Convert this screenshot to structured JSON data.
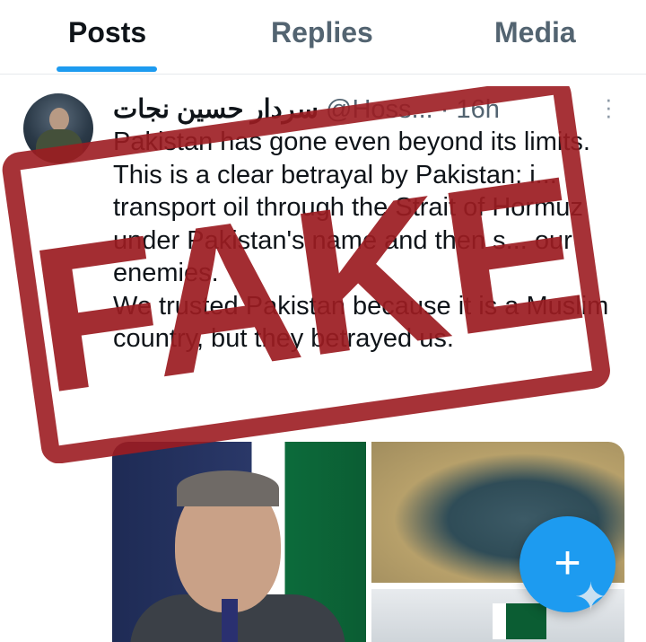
{
  "tabs": [
    {
      "label": "Posts"
    },
    {
      "label": "Replies"
    },
    {
      "label": "Media"
    }
  ],
  "post": {
    "display_name": "سردار حسين نجات",
    "handle": "@Hoss... · 16h",
    "text_lines": [
      "Pakistan has gone even beyond its limits.",
      "This is a clear betrayal by Pakistan: i... transport oil through the Strait of Hormuz under Pakistan's name and then s... our enemies.",
      "We trusted Pakistan because it is a Muslim country, but they betrayed us."
    ]
  },
  "stamp": {
    "text": "FAKE",
    "color": "#9c1c21"
  },
  "fab": {
    "icon": "plus-icon",
    "label": "+"
  },
  "colors": {
    "accent": "#1d9bf0",
    "text": "#0f1419",
    "muted": "#536471"
  }
}
